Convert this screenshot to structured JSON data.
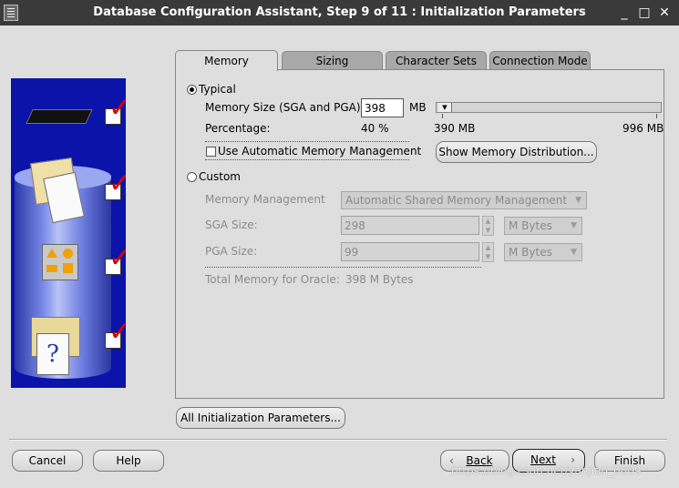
{
  "window": {
    "title": "Database Configuration Assistant, Step 9 of 11 : Initialization Parameters",
    "minimize_glyph": "_",
    "maximize_glyph": "□",
    "close_glyph": "✕"
  },
  "tabs": [
    {
      "label": "Memory",
      "active": true
    },
    {
      "label": "Sizing",
      "active": false
    },
    {
      "label": "Character Sets",
      "active": false
    },
    {
      "label": "Connection Mode",
      "active": false
    }
  ],
  "memory": {
    "typical_label": "Typical",
    "typical_selected": true,
    "memory_size_label": "Memory Size (SGA and PGA):",
    "memory_size_value": "398",
    "memory_size_unit": "MB",
    "slider_min_label": "390 MB",
    "slider_max_label": "996 MB",
    "slider_position_fraction": 0.0,
    "percentage_label": "Percentage:",
    "percentage_value": "40 %",
    "auto_mm_label": "Use Automatic Memory Management",
    "auto_mm_checked": false,
    "show_distribution_button": "Show Memory Distribution...",
    "custom_label": "Custom",
    "custom_selected": false,
    "memory_management_label": "Memory Management",
    "memory_management_value": "Automatic Shared Memory Management",
    "sga_size_label": "SGA Size:",
    "sga_size_value": "298",
    "sga_unit": "M Bytes",
    "pga_size_label": "PGA Size:",
    "pga_size_value": "99",
    "pga_unit": "M Bytes",
    "total_memory_label": "Total Memory for Oracle:",
    "total_memory_value": "398 M Bytes"
  },
  "all_init_params_button": "All Initialization Parameters...",
  "footer": {
    "cancel": "Cancel",
    "help": "Help",
    "back": "Back",
    "next": "Next",
    "finish": "Finish"
  },
  "watermark": "https://blog.csdn.net/yanjian_0809",
  "colors": {
    "titlebar": "#3a3a3a",
    "illustration_bg": "#0b13a8",
    "check_red": "#dd0000"
  },
  "icons": [
    "app-icon",
    "chip-icon",
    "documents-icon",
    "shapes-icon",
    "help-folder-icon",
    "check-icon"
  ]
}
